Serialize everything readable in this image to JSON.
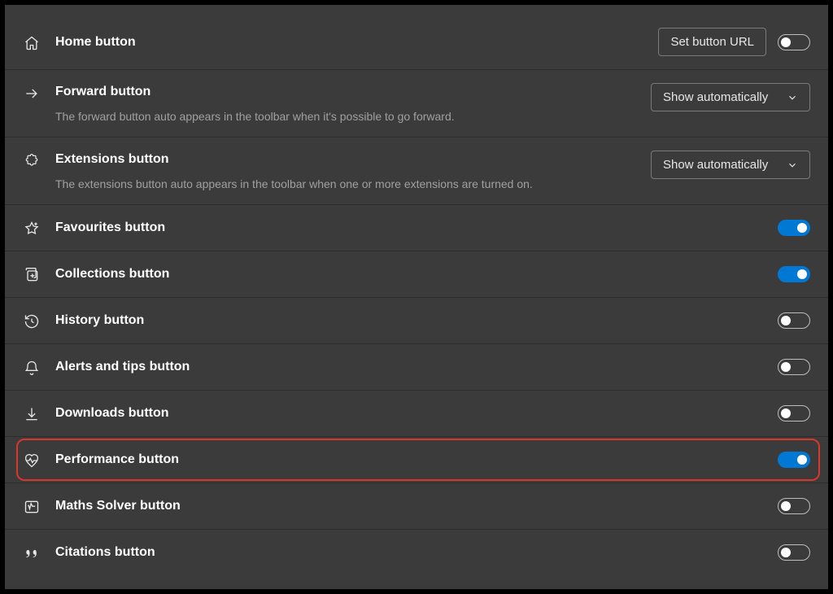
{
  "rows": {
    "home": {
      "title": "Home button",
      "url_btn": "Set button URL"
    },
    "forward": {
      "title": "Forward button",
      "desc": "The forward button auto appears in the toolbar when it's possible to go forward.",
      "dropdown": "Show automatically"
    },
    "extensions": {
      "title": "Extensions button",
      "desc": "The extensions button auto appears in the toolbar when one or more extensions are turned on.",
      "dropdown": "Show automatically"
    },
    "favourites": {
      "title": "Favourites button"
    },
    "collections": {
      "title": "Collections button"
    },
    "history": {
      "title": "History button"
    },
    "alerts": {
      "title": "Alerts and tips button"
    },
    "downloads": {
      "title": "Downloads button"
    },
    "performance": {
      "title": "Performance button"
    },
    "maths": {
      "title": "Maths Solver button"
    },
    "citations": {
      "title": "Citations button"
    }
  }
}
